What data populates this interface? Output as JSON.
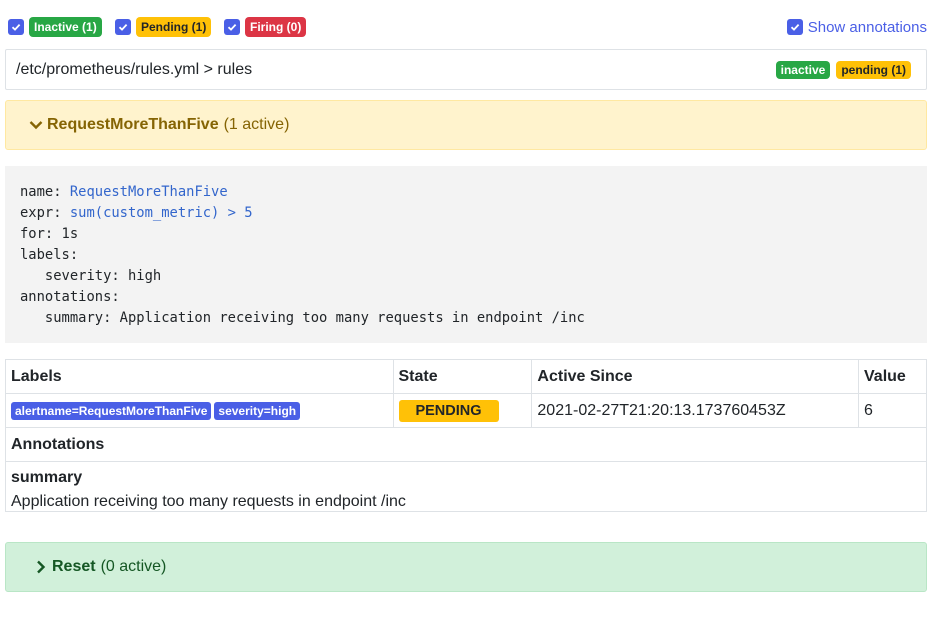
{
  "filters": {
    "inactive_label": "Inactive (1)",
    "pending_label": "Pending (1)",
    "firing_label": "Firing (0)",
    "show_annotations_label": "Show annotations"
  },
  "file": {
    "path": "/etc/prometheus/rules.yml > rules",
    "badge_inactive": "inactive",
    "badge_pending": "pending (1)"
  },
  "group": {
    "title": "RequestMoreThanFive",
    "count": "(1 active)"
  },
  "rule": {
    "name_key": "name: ",
    "name_val": "RequestMoreThanFive",
    "expr_key": "expr: ",
    "expr_val": "sum(custom_metric) > 5",
    "for_line": "for: 1s",
    "labels_line": "labels:",
    "severity_line": "   severity: high",
    "annotations_line": "annotations:",
    "summary_line": "   summary: Application receiving too many requests in endpoint /inc"
  },
  "table": {
    "headers": [
      "Labels",
      "State",
      "Active Since",
      "Value"
    ],
    "row": {
      "labels": [
        "alertname=RequestMoreThanFive",
        "severity=high"
      ],
      "state": "PENDING",
      "active_since": "2021-02-27T21:20:13.173760453Z",
      "value": "6"
    },
    "annotations_title": "Annotations",
    "annotation_key": "summary",
    "annotation_value": "Application receiving too many requests in endpoint /inc"
  },
  "reset": {
    "title": "Reset",
    "count": "(0 active)"
  },
  "colors": {
    "accent": "#4a5fe6",
    "inactive": "#28a745",
    "pending": "#ffc107",
    "firing": "#dc3545"
  },
  "icons": {
    "checkbox": "check-icon",
    "expanded": "chevron-down-icon",
    "collapsed": "chevron-right-icon"
  }
}
